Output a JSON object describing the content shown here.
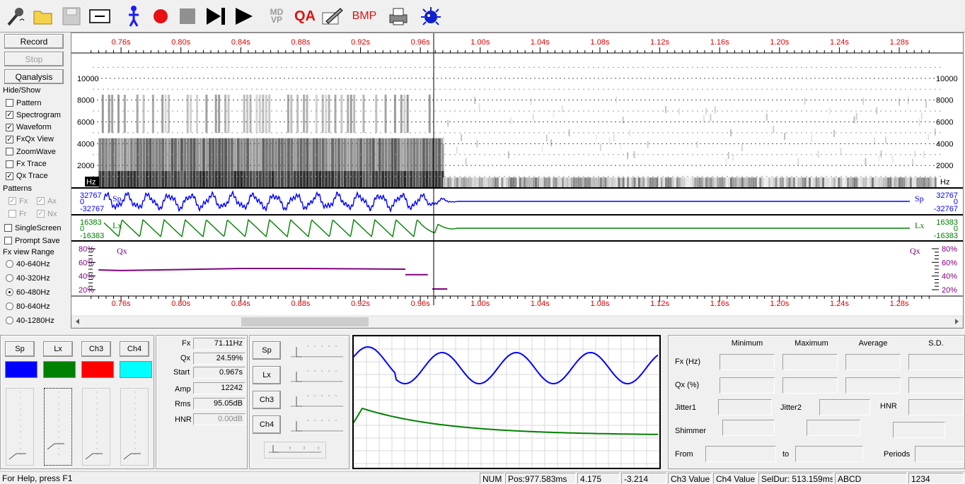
{
  "toolbar": {
    "mdvp_label": "MD\nVP",
    "qa_label": "QA",
    "bmp_label": "BMP"
  },
  "left_panel": {
    "record_label": "Record",
    "stop_label": "Stop",
    "qanalysis_label": "Qanalysis",
    "hide_show_label": "Hide/Show",
    "checks": [
      {
        "label": "Pattern",
        "checked": false
      },
      {
        "label": "Spectrogram",
        "checked": true
      },
      {
        "label": "Waveform",
        "checked": true
      },
      {
        "label": "FxQx View",
        "checked": true
      },
      {
        "label": "ZoomWave",
        "checked": false
      },
      {
        "label": "Fx Trace",
        "checked": false
      },
      {
        "label": "Qx Trace",
        "checked": true
      }
    ],
    "patterns_label": "Patterns",
    "pattern_checks": [
      {
        "label": "Fx",
        "checked": true
      },
      {
        "label": "Ax",
        "checked": true
      },
      {
        "label": "Fr",
        "checked": false
      },
      {
        "label": "Nx",
        "checked": true
      }
    ],
    "single_screen_label": "SingleScreen",
    "prompt_save_label": "Prompt Save",
    "fx_range_label": "Fx view Range",
    "ranges": [
      "40-640Hz",
      "40-320Hz",
      "60-480Hz",
      "80-640Hz",
      "40-1280Hz"
    ],
    "selected_range": "60-480Hz"
  },
  "time_axis": {
    "ticks": [
      "0.76s",
      "0.80s",
      "0.84s",
      "0.88s",
      "0.92s",
      "0.96s",
      "1.00s",
      "1.04s",
      "1.08s",
      "1.12s",
      "1.16s",
      "1.20s",
      "1.24s",
      "1.28s"
    ]
  },
  "spectrogram": {
    "freq_labels": [
      "10000",
      "8000",
      "6000",
      "4000",
      "2000"
    ],
    "unit": "Hz"
  },
  "waveform_sp": {
    "label": "Sp",
    "top": "32767",
    "mid": "0",
    "bottom": "-32767",
    "color": "#0000ff"
  },
  "waveform_lx": {
    "label": "Lx",
    "top": "16383",
    "mid": "0",
    "bottom": "-16383",
    "color": "#008000"
  },
  "qx_trace": {
    "label": "Qx",
    "levels": [
      "80%",
      "60%",
      "40%",
      "20%"
    ],
    "color": "#800080"
  },
  "channels": [
    {
      "label": "Sp",
      "color": "#0000ff"
    },
    {
      "label": "Lx",
      "color": "#008000"
    },
    {
      "label": "Ch3",
      "color": "#ff0000"
    },
    {
      "label": "Ch4",
      "color": "#00ffff"
    }
  ],
  "measures": {
    "fx_label": "Fx",
    "fx_value": "71.11Hz",
    "qx_label": "Qx",
    "qx_value": "24.59%",
    "start_label": "Start",
    "start_value": "0.967s",
    "amp_label": "Amp",
    "amp_value": "12242",
    "rms_label": "Rms",
    "rms_value": "95.05dB",
    "hnr_label": "HNR",
    "hnr_value": "0.00dB"
  },
  "mixer": {
    "labels": [
      "Sp",
      "Lx",
      "Ch3",
      "Ch4"
    ]
  },
  "stats": {
    "col_min": "Minimum",
    "col_max": "Maximum",
    "col_avg": "Average",
    "col_sd": "S.D.",
    "fx_label": "Fx (Hz)",
    "qx_label": "Qx (%)",
    "jitter1_label": "Jitter1",
    "jitter2_label": "Jitter2",
    "hnr_label": "HNR",
    "shimmer_label": "Shimmer",
    "from_label": "From",
    "to_label": "to",
    "periods_label": "Periods"
  },
  "status_bar": {
    "help": "For Help, press F1",
    "num": "NUM",
    "pos": "Pos:977.583ms",
    "v1": "4.175",
    "v2": "-3.214",
    "ch3": "Ch3 Value",
    "ch4": "Ch4 Value",
    "seldur": "SelDur: 513.159ms",
    "abcd": "ABCD",
    "code": "1234"
  }
}
